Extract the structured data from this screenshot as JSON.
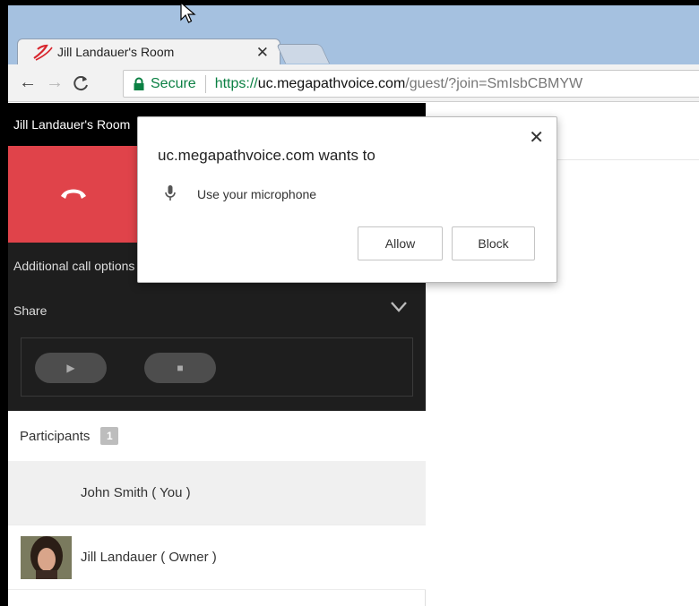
{
  "browser": {
    "tab": {
      "title": "Jill Landauer's Room",
      "close_glyph": "✕"
    },
    "nav": {
      "back": "←",
      "forward": "→",
      "reload": "C"
    },
    "omnibox": {
      "secure_label": "Secure",
      "url_scheme": "https://",
      "url_host": "uc.megapathvoice.com",
      "url_path": "/guest/?join=SmIsbCBMYW"
    }
  },
  "popup": {
    "title": "uc.megapathvoice.com wants to",
    "permission": "Use your microphone",
    "close_glyph": "✕",
    "allow_label": "Allow",
    "block_label": "Block"
  },
  "room": {
    "header": "Jill Landauer's Room",
    "call_options_label": "Additional call options",
    "share_label": "Share",
    "play_glyph": "▶",
    "stop_glyph": "■"
  },
  "participants": {
    "label": "Participants",
    "count": "1",
    "list": [
      {
        "name": "John Smith  ( You )"
      },
      {
        "name": "Jill Landauer  ( Owner )"
      }
    ]
  },
  "colors": {
    "tabstrip": "#a5c1e0",
    "hangup_red": "#e0434a",
    "dark_panel": "#1e1e1e",
    "secure_green": "#0b8043"
  }
}
